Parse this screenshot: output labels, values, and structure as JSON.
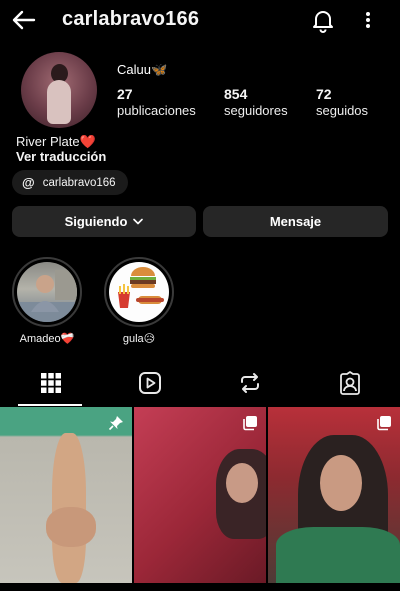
{
  "header": {
    "username": "carlabravo166",
    "back_icon": "arrow-left-icon",
    "bell_icon": "bell-icon",
    "more_icon": "more-vertical-icon"
  },
  "profile": {
    "display_name": "Caluu🦋",
    "stats": [
      {
        "value": "27",
        "label": "publicaciones"
      },
      {
        "value": "854",
        "label": "seguidores"
      },
      {
        "value": "72",
        "label": "seguidos"
      }
    ],
    "bio": "River Plate❤️",
    "translate_label": "Ver traducción",
    "threads_handle": "carlabravo166"
  },
  "actions": {
    "follow_label": "Siguiendo",
    "message_label": "Mensaje"
  },
  "highlights": [
    {
      "title": "Amadeo❤️‍🩹"
    },
    {
      "title": "gula😥"
    }
  ],
  "tabs": [
    {
      "icon": "grid-icon",
      "active": true
    },
    {
      "icon": "reels-icon",
      "active": false
    },
    {
      "icon": "reposts-icon",
      "active": false
    },
    {
      "icon": "tagged-icon",
      "active": false
    }
  ],
  "posts": [
    {
      "badge": "pin-icon"
    },
    {
      "badge": "carousel-icon"
    },
    {
      "badge": "carousel-icon"
    }
  ],
  "colors": {
    "background": "#000000",
    "button": "#262626",
    "text": "#f5f5f5"
  }
}
